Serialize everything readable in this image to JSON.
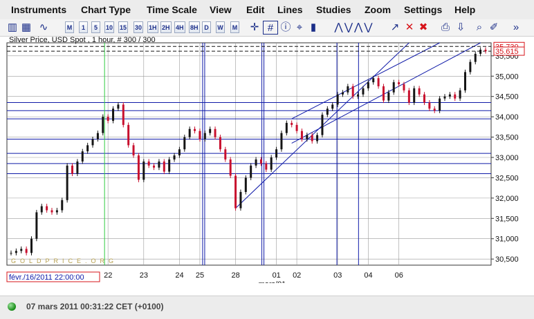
{
  "menu": [
    "Instruments",
    "Chart Type",
    "Time Scale",
    "View",
    "Edit",
    "Lines",
    "Studies",
    "Zoom",
    "Settings",
    "Help"
  ],
  "toolbar": {
    "timeframes": [
      "M",
      "1",
      "5",
      "10",
      "15",
      "30",
      "1H",
      "2H",
      "4H",
      "8H",
      "D",
      "W",
      "M"
    ],
    "icons": [
      "candlestick-chart-icon",
      "bar-chart-icon",
      "line-chart-icon",
      "crosshair-icon",
      "grid-icon",
      "info-icon",
      "cursor-icon",
      "volume-icon",
      "fan-tool-icon",
      "draw-line-icon",
      "delete-line-icon",
      "delete-all-icon",
      "print-icon",
      "export-icon",
      "zoom-icon",
      "pin-icon",
      "more-icon"
    ]
  },
  "chart_data": {
    "type": "candlestick",
    "title": "Silver Price, USD Spot , 1 hour, # 300 / 300",
    "watermark": "GOLDPRICE.ORG",
    "current_price_labels": [
      "35.730",
      "35.615"
    ],
    "cursor_date": "févr./16/2011 22:00:00",
    "x_tick_labels": [
      "22",
      "23",
      "24",
      "25",
      "28",
      "01",
      "02",
      "03",
      "04",
      "06"
    ],
    "x_sublabel": "mars/01",
    "y_tick_labels": [
      "35,500",
      "35,000",
      "34,500",
      "34,000",
      "33,500",
      "33,000",
      "32,500",
      "32,000",
      "31,500",
      "31,000",
      "30,500"
    ],
    "ylim": [
      30350,
      35820
    ],
    "close_series": [
      30650,
      30700,
      30750,
      30650,
      31000,
      31650,
      31800,
      31700,
      31650,
      31700,
      31950,
      32800,
      32600,
      32900,
      33150,
      33300,
      33450,
      33600,
      34000,
      33900,
      34200,
      34300,
      33800,
      33300,
      33050,
      32450,
      32900,
      32800,
      32750,
      32900,
      32650,
      32950,
      33050,
      33200,
      33500,
      33700,
      33650,
      33450,
      33600,
      33700,
      33500,
      33200,
      32950,
      32550,
      31750,
      32150,
      32500,
      32800,
      32950,
      32850,
      32700,
      33000,
      33200,
      33600,
      33850,
      33800,
      33650,
      33450,
      33550,
      33400,
      33550,
      34050,
      34200,
      34300,
      34550,
      34600,
      34750,
      34500,
      34550,
      34700,
      34850,
      34950,
      34750,
      34400,
      34600,
      34850,
      34800,
      34650,
      34350,
      34700,
      34550,
      34350,
      34200,
      34150,
      34450,
      34500,
      34550,
      34450,
      34650,
      35100,
      35350,
      35550,
      35650,
      35615
    ],
    "horizontal_levels": [
      34350,
      34150,
      33950,
      33450,
      33100,
      32850,
      32600
    ],
    "vertical_markers_date": [
      "25",
      "28",
      "02",
      "04"
    ],
    "green_marker_date": "22"
  },
  "footer": {
    "status_text": "07 mars 2011 00:31:22  CET (+0100)"
  },
  "colors": {
    "grid": "#9a9a9a",
    "lines": "#0f1aa8",
    "candle_up": "#151515",
    "candle_down": "#c8102e",
    "green_marker": "#2ecc40",
    "label_red": "#d7141a",
    "watermark": "#b59e4a"
  }
}
